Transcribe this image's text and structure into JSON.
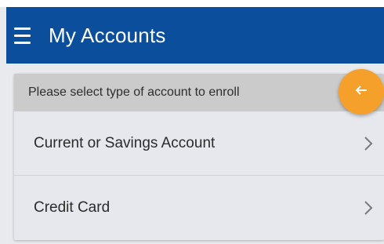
{
  "header": {
    "title": "My Accounts",
    "menu_icon": "menu-icon",
    "background_color": "#0b4f9c"
  },
  "card": {
    "prompt": "Please select type of account to enroll",
    "options": [
      {
        "label": "Current or Savings Account",
        "icon": "chevron-right-icon"
      },
      {
        "label": "Credit Card",
        "icon": "chevron-right-icon"
      }
    ]
  },
  "fab": {
    "icon": "arrow-left-icon",
    "color": "#f5a02a"
  }
}
